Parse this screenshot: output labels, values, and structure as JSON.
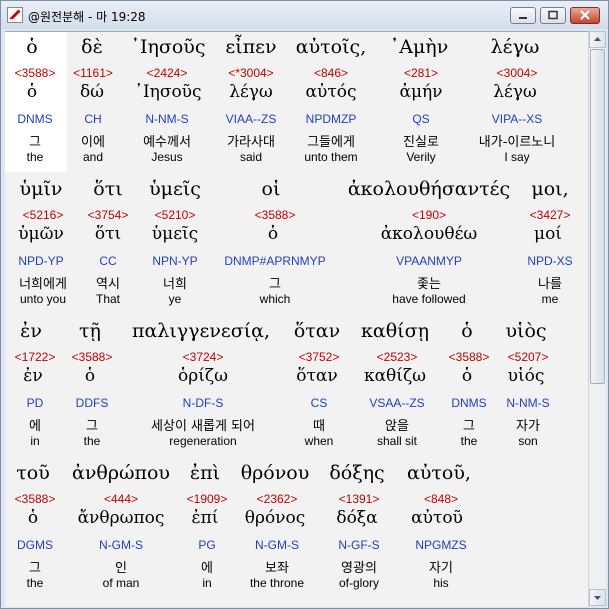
{
  "window": {
    "title": "@원전분해 - 마 19:28"
  },
  "rows": [
    {
      "words": [
        {
          "greek": "ὁ",
          "strong": "<3588>",
          "lemma": "ὁ",
          "parse": "DNMS",
          "korean": "그",
          "english": "the"
        },
        {
          "greek": "δὲ",
          "strong": "<1161>",
          "lemma": "δώ",
          "parse": "CH",
          "korean": "이에",
          "english": "and"
        },
        {
          "greek": "᾿Ιησοῦς",
          "strong": "<2424>",
          "lemma": "᾿Ιησοῦς",
          "parse": "N-NM-S",
          "korean": "예수께서",
          "english": "Jesus"
        },
        {
          "greek": "εἶπεν",
          "strong": "<*3004>",
          "lemma": "λέγω",
          "parse": "VIAA--ZS",
          "korean": "가라사대",
          "english": "said"
        },
        {
          "greek": "αὐτοῖς,",
          "strong": "<846>",
          "lemma": "αὐτός",
          "parse": "NPDMZP",
          "korean": "그들에게",
          "english": "unto them"
        },
        {
          "greek": "᾿Αμὴν",
          "strong": "<281>",
          "lemma": "ἀμήν",
          "parse": "QS",
          "korean": "진실로",
          "english": "Verily"
        },
        {
          "greek": "λέγω",
          "strong": "<3004>",
          "lemma": "λέγω",
          "parse": "VIPA--XS",
          "korean": "내가-이르노니",
          "english": "I say"
        }
      ]
    },
    {
      "words": [
        {
          "greek": "ὑμῖν",
          "strong": "<5216>",
          "lemma": "ὑμῶν",
          "parse": "NPD-YP",
          "korean": "너희에게",
          "english": "unto you"
        },
        {
          "greek": "ὅτι",
          "strong": "<3754>",
          "lemma": "ὅτι",
          "parse": "CC",
          "korean": "역시",
          "english": "That"
        },
        {
          "greek": "ὑμεῖς",
          "strong": "<5210>",
          "lemma": "ὑμεῖς",
          "parse": "NPN-YP",
          "korean": "너희",
          "english": "ye"
        },
        {
          "greek": "οἱ",
          "strong": "<3588>",
          "lemma": "ὁ",
          "parse": "DNMP#APRNMYP",
          "korean": "그",
          "english": "which"
        },
        {
          "greek": "ἀκολουθήσαντές",
          "strong": "<190>",
          "lemma": "ἀκολουθέω",
          "parse": "VPAANMYP",
          "korean": "좇는",
          "english": "have followed"
        },
        {
          "greek": "μοι,",
          "strong": "<3427>",
          "lemma": "μοί",
          "parse": "NPD-XS",
          "korean": "나를",
          "english": "me"
        }
      ]
    },
    {
      "words": [
        {
          "greek": "ἐν",
          "strong": "<1722>",
          "lemma": "ἐν",
          "parse": "PD",
          "korean": "에",
          "english": "in"
        },
        {
          "greek": "τῇ",
          "strong": "<3588>",
          "lemma": "ὁ",
          "parse": "DDFS",
          "korean": "그",
          "english": "the"
        },
        {
          "greek": "παλιγγενεσίᾳ,",
          "strong": "<3724>",
          "lemma": "ὁρίζω",
          "parse": "N-DF-S",
          "korean": "세상이 새롭게 되어",
          "english": "regeneration"
        },
        {
          "greek": "ὅταν",
          "strong": "<3752>",
          "lemma": "ὅταν",
          "parse": "CS",
          "korean": "때",
          "english": "when"
        },
        {
          "greek": "καθίσῃ",
          "strong": "<2523>",
          "lemma": "καθίζω",
          "parse": "VSAA--ZS",
          "korean": "앉을",
          "english": "shall sit"
        },
        {
          "greek": "ὁ",
          "strong": "<3588>",
          "lemma": "ὁ",
          "parse": "DNMS",
          "korean": "그",
          "english": "the"
        },
        {
          "greek": "υἱὸς",
          "strong": "<5207>",
          "lemma": "υἱός",
          "parse": "N-NM-S",
          "korean": "자가",
          "english": "son"
        }
      ]
    },
    {
      "words": [
        {
          "greek": "τοῦ",
          "strong": "<3588>",
          "lemma": "ὁ",
          "parse": "DGMS",
          "korean": "그",
          "english": "the"
        },
        {
          "greek": "ἀνθρώπου",
          "strong": "<444>",
          "lemma": "ἄνθρωπος",
          "parse": "N-GM-S",
          "korean": "인",
          "english": "of man"
        },
        {
          "greek": "ἐπὶ",
          "strong": "<1909>",
          "lemma": "ἐπί",
          "parse": "PG",
          "korean": "에",
          "english": "in"
        },
        {
          "greek": "θρόνου",
          "strong": "<2362>",
          "lemma": "θρόνος",
          "parse": "N-GM-S",
          "korean": "보좌",
          "english": "the throne"
        },
        {
          "greek": "δόξης",
          "strong": "<1391>",
          "lemma": "δόξα",
          "parse": "N-GF-S",
          "korean": "영광의",
          "english": "of-glory"
        },
        {
          "greek": "αὐτοῦ,",
          "strong": "<848>",
          "lemma": "αὐτοῦ",
          "parse": "NPGMZS",
          "korean": "자기",
          "english": "his"
        }
      ]
    }
  ],
  "colors": {
    "strong": "#c00000",
    "parse": "#1f3fbf",
    "text": "#000000"
  }
}
